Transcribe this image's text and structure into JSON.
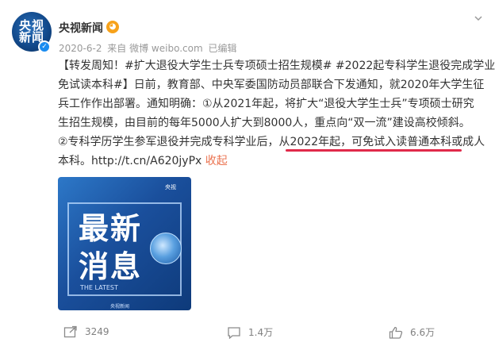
{
  "post": {
    "author": "央视新闻",
    "avatar_text": "央视新闻",
    "meta": {
      "date": "2020-6-2",
      "source": "来自 微博 weibo.com",
      "edited": "已编辑"
    },
    "content_lines": [
      {
        "prefix": "【转发周知！#扩大退役大学生士兵专项硕士招生规模# #2022起专科学生退役完成学业",
        "suffix": ""
      },
      {
        "prefix": "免试读本科#】日前，教育部、中央军委国防动员部联合下发通知，就2020年大学生征",
        "suffix": ""
      },
      {
        "prefix": "兵工作作出部署。通知明确：①从2021年起，将扩大“退役大学生士兵”专项硕士研究",
        "suffix": ""
      },
      {
        "prefix": "生招生规模，由目前的每年5000人扩大到8000人，重点向“双一流”建设高校倾斜。",
        "suffix": ""
      },
      {
        "prefix": "②专科学历学生参军退役并完成专科学业后，从2022年起，可免试入读普通本科或成人",
        "suffix": ""
      }
    ],
    "last_line_link": "本科。http://t.cn/A620jyPx",
    "collapse_label": "收起",
    "image": {
      "line1": "最新",
      "line2": "消息",
      "tag": "THE LATEST",
      "logo": "央视",
      "footer": "央视新闻"
    }
  },
  "actions": {
    "repost_count": "3249",
    "comment_count": "1.4万",
    "like_count": "6.6万"
  },
  "colors": {
    "link": "#eb7350",
    "underline": "#e02a4a",
    "meta": "#999999"
  }
}
